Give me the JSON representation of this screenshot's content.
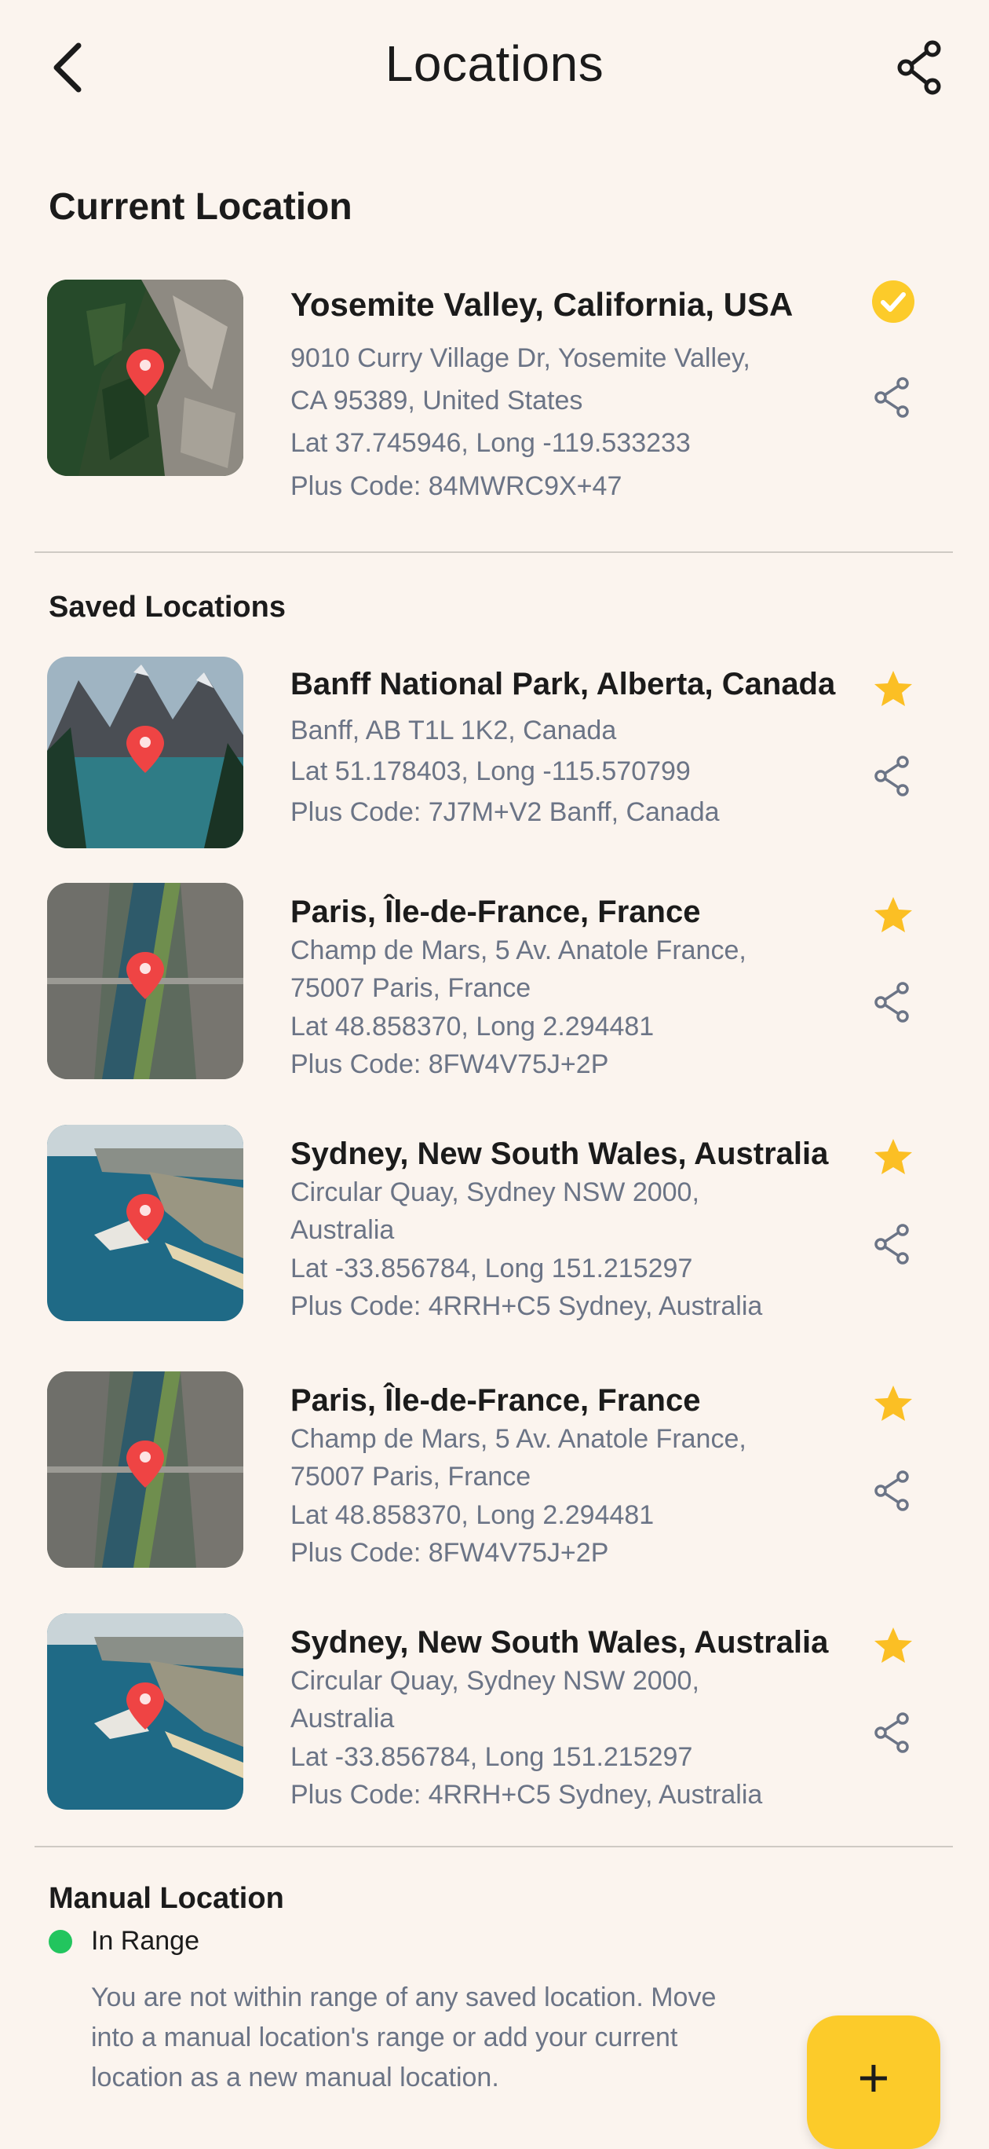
{
  "header": {
    "title": "Locations",
    "back_icon": "chevron-left-icon",
    "share_icon": "share-icon"
  },
  "current": {
    "section_title": "Current Location",
    "name": "Yosemite Valley, California, USA",
    "lines": [
      "9010 Curry Village Dr, Yosemite Valley,",
      "CA 95389, United States",
      "Lat 37.745946, Long -119.533233",
      "Plus Code: 84MWRC9X+47"
    ],
    "status_icon": "check-circle-icon"
  },
  "saved": {
    "section_title": "Saved Locations",
    "items": [
      {
        "name": "Banff National Park, Alberta, Canada",
        "lines": [
          "Banff, AB T1L 1K2, Canada",
          "Lat 51.178403, Long -115.570799",
          "Plus Code: 7J7M+V2 Banff, Canada"
        ],
        "thumb": "banff"
      },
      {
        "name": "Paris, Île-de-France, France",
        "lines": [
          "Champ de Mars, 5 Av. Anatole France,",
          "75007 Paris, France",
          "Lat 48.858370, Long 2.294481",
          "Plus Code: 8FW4V75J+2P"
        ],
        "thumb": "paris"
      },
      {
        "name": "Sydney, New South Wales, Australia",
        "lines": [
          "Circular Quay, Sydney NSW 2000,",
          "Australia",
          "Lat -33.856784, Long 151.215297",
          "Plus Code: 4RRH+C5 Sydney, Australia"
        ],
        "thumb": "sydney"
      },
      {
        "name": "Paris, Île-de-France, France",
        "lines": [
          "Champ de Mars, 5 Av. Anatole France,",
          "75007 Paris, France",
          "Lat 48.858370, Long 2.294481",
          "Plus Code: 8FW4V75J+2P"
        ],
        "thumb": "paris"
      },
      {
        "name": "Sydney, New South Wales, Australia",
        "lines": [
          "Circular Quay, Sydney NSW 2000,",
          "Australia",
          "Lat -33.856784, Long 151.215297",
          "Plus Code: 4RRH+C5 Sydney, Australia"
        ],
        "thumb": "sydney"
      }
    ]
  },
  "manual": {
    "section_title": "Manual Location",
    "status_label": "In Range",
    "status_color": "#22c55e",
    "description": "You are not within range of any saved location. Move into a manual location's range or add your current location as a new manual location."
  },
  "fab": {
    "label": "+",
    "icon": "plus-icon"
  },
  "colors": {
    "background": "#fbf4ee",
    "accent": "#fccb2a",
    "pin": "#ef4444",
    "muted_text": "#6b7486"
  }
}
